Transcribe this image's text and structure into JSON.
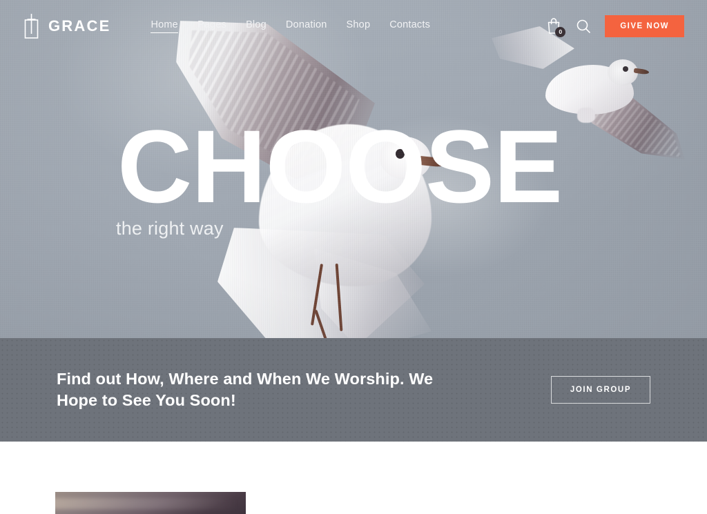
{
  "header": {
    "brand": {
      "name": "GRACE",
      "icon": "church-book-icon"
    },
    "nav": [
      {
        "label": "Home",
        "active": true
      },
      {
        "label": "Pages",
        "active": false
      },
      {
        "label": "Blog",
        "active": false
      },
      {
        "label": "Donation",
        "active": false
      },
      {
        "label": "Shop",
        "active": false
      },
      {
        "label": "Contacts",
        "active": false
      }
    ],
    "cart": {
      "icon": "shopping-bag-icon",
      "count": "0"
    },
    "search": {
      "icon": "search-icon"
    },
    "give_button": "GIVE NOW"
  },
  "hero": {
    "title": "CHOOSE",
    "subtitle": "the right way"
  },
  "cta": {
    "text": "Find out How, Where and When We Worship. We Hope to See You Soon!",
    "button": "JOIN GROUP"
  },
  "colors": {
    "accent": "#f4633f",
    "hero_bg": "#a4acb6",
    "band_bg": "#6e737b",
    "badge_bg": "#3a3136",
    "text_light": "#ffffff"
  }
}
